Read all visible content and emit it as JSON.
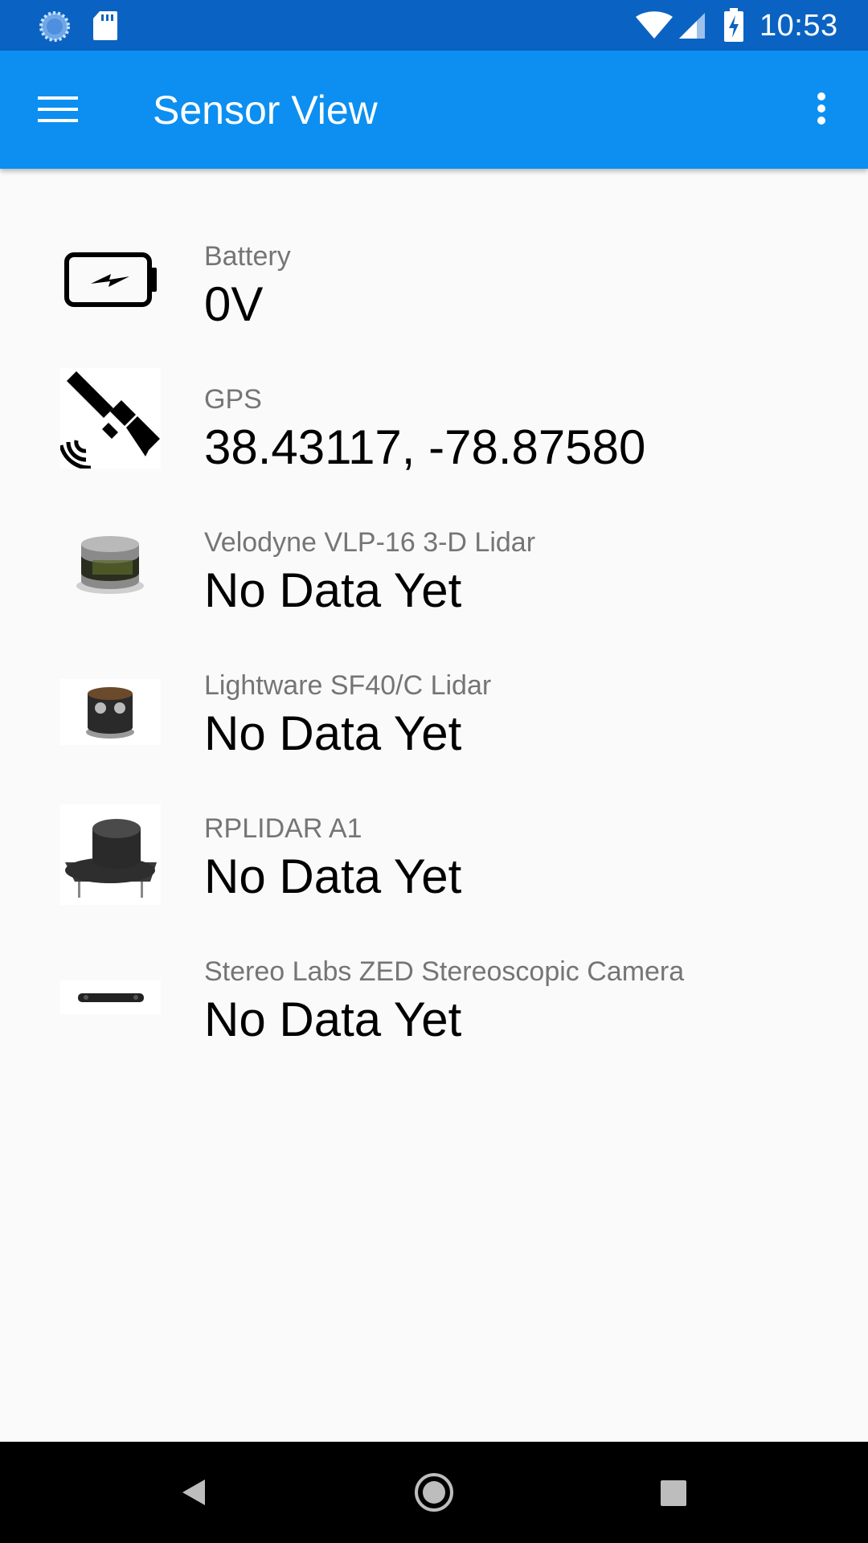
{
  "status_bar": {
    "time": "10:53",
    "icons": [
      "sync-icon",
      "sd-card-icon",
      "wifi-icon",
      "cell-signal-icon",
      "battery-charging-icon"
    ]
  },
  "app_bar": {
    "title": "Sensor View",
    "menu_icon": "hamburger-menu-icon",
    "overflow_icon": "more-vert-icon"
  },
  "sensors": [
    {
      "label": "Battery",
      "value": "0V",
      "icon": "battery-icon"
    },
    {
      "label": "GPS",
      "value": "38.43117, -78.87580",
      "icon": "satellite-icon"
    },
    {
      "label": "Velodyne VLP-16 3-D Lidar",
      "value": "No Data Yet",
      "icon": "velodyne-lidar-image"
    },
    {
      "label": "Lightware SF40/C Lidar",
      "value": "No Data Yet",
      "icon": "lightware-lidar-image"
    },
    {
      "label": "RPLIDAR A1",
      "value": "No Data Yet",
      "icon": "rplidar-image"
    },
    {
      "label": "Stereo Labs ZED Stereoscopic Camera",
      "value": "No Data Yet",
      "icon": "zed-camera-image"
    }
  ],
  "nav_bar": {
    "buttons": [
      "back-icon",
      "home-icon",
      "recents-icon"
    ]
  },
  "colors": {
    "status_bar": "#0a63c2",
    "app_bar": "#0c8ff0",
    "background": "#fafafa",
    "label_text": "#757575",
    "value_text": "#000000"
  }
}
